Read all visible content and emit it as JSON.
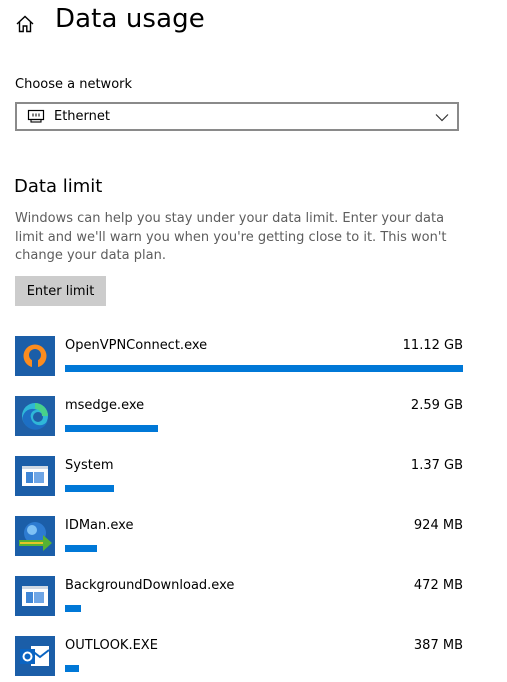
{
  "header": {
    "title": "Data usage",
    "home_icon": "home-icon"
  },
  "network": {
    "label": "Choose a network",
    "selected": "Ethernet",
    "icon": "ethernet-icon"
  },
  "data_limit": {
    "title": "Data limit",
    "description": "Windows can help you stay under your data limit. Enter your data limit and we'll warn you when you're getting close to it. This won't change your data plan.",
    "button_label": "Enter limit"
  },
  "accent_color": "#0078d7",
  "apps": [
    {
      "name": "OpenVPNConnect.exe",
      "usage": "11.12 GB",
      "usage_fraction": 1.0,
      "icon": "openvpn-icon"
    },
    {
      "name": "msedge.exe",
      "usage": "2.59 GB",
      "usage_fraction": 0.233,
      "icon": "edge-icon"
    },
    {
      "name": "System",
      "usage": "1.37 GB",
      "usage_fraction": 0.123,
      "icon": "system-window-icon"
    },
    {
      "name": "IDMan.exe",
      "usage": "924 MB",
      "usage_fraction": 0.081,
      "icon": "idm-icon"
    },
    {
      "name": "BackgroundDownload.exe",
      "usage": "472 MB",
      "usage_fraction": 0.041,
      "icon": "system-window-icon"
    },
    {
      "name": "OUTLOOK.EXE",
      "usage": "387 MB",
      "usage_fraction": 0.034,
      "icon": "outlook-icon"
    }
  ]
}
